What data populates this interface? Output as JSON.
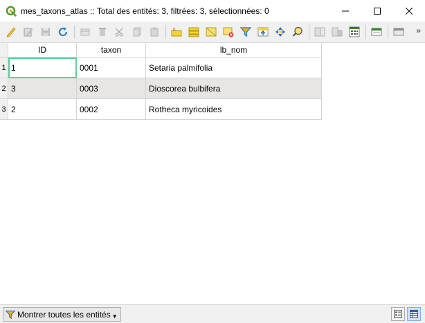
{
  "window": {
    "title": "mes_taxons_atlas :: Total des entités: 3, filtrées: 3, sélectionnées: 0"
  },
  "toolbar": {
    "icons": [
      "edit-pencil-icon",
      "multi-edit-icon",
      "save-icon",
      "reload-icon",
      "add-feature-icon",
      "delete-feature-icon",
      "cut-icon",
      "copy-icon",
      "paste-icon",
      "select-by-expression-icon",
      "select-all-icon",
      "invert-selection-icon",
      "deselect-icon",
      "filter-icon",
      "move-selection-top-icon",
      "pan-to-selection-icon",
      "zoom-to-selection-icon",
      "new-field-icon",
      "delete-field-icon",
      "field-calculator-icon",
      "conditional-formatting-icon",
      "actions-icon"
    ],
    "more": "»"
  },
  "table": {
    "columns": [
      "ID",
      "taxon",
      "lb_nom"
    ],
    "rows": [
      {
        "num": "1",
        "id": "1",
        "taxon": "0001",
        "lb_nom": "Setaria palmifolia"
      },
      {
        "num": "2",
        "id": "3",
        "taxon": "0003",
        "lb_nom": "Dioscorea bulbifera"
      },
      {
        "num": "3",
        "id": "2",
        "taxon": "0002",
        "lb_nom": "Rotheca myricoides"
      }
    ]
  },
  "bottom": {
    "filter_label": "Montrer toutes les entités"
  },
  "colors": {
    "accent_current_cell": "#5ccf97",
    "alt_row": "#e8e6e3",
    "app_icon": "#589632"
  }
}
